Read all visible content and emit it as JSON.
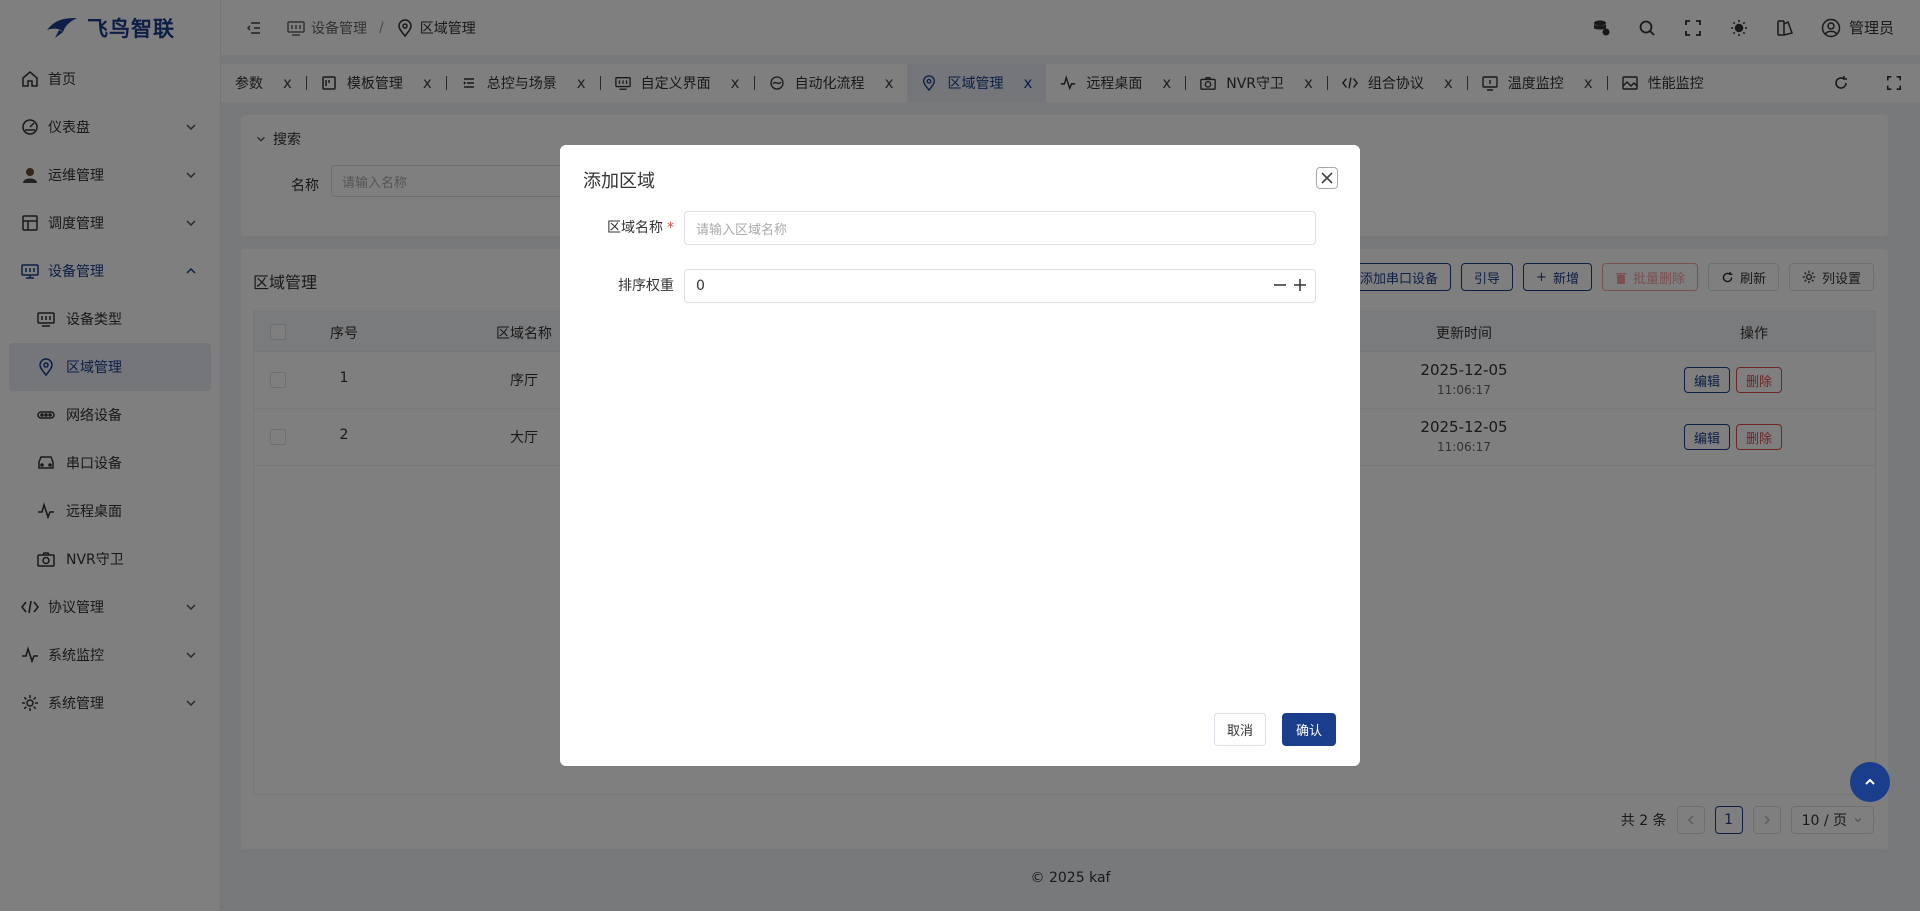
{
  "app": {
    "name": "飞鸟智联"
  },
  "colors": {
    "brand": "#1a3e8c",
    "danger": "#e04a4a",
    "overlay": "rgba(0,0,0,0.5)"
  },
  "sidebar": {
    "items": [
      {
        "label": "首页",
        "icon": "home-icon"
      },
      {
        "label": "仪表盘",
        "icon": "dashboard-icon"
      },
      {
        "label": "运维管理",
        "icon": "operator-icon"
      },
      {
        "label": "调度管理",
        "icon": "schedule-icon"
      },
      {
        "label": "设备管理",
        "icon": "device-icon"
      },
      {
        "label": "协议管理",
        "icon": "code-icon"
      },
      {
        "label": "系统监控",
        "icon": "pulse-icon"
      },
      {
        "label": "系统管理",
        "icon": "gear-icon"
      }
    ],
    "device_children": [
      {
        "label": "设备类型",
        "icon": "monitor-icon"
      },
      {
        "label": "区域管理",
        "icon": "location-icon"
      },
      {
        "label": "网络设备",
        "icon": "network-icon"
      },
      {
        "label": "串口设备",
        "icon": "serial-icon"
      },
      {
        "label": "远程桌面",
        "icon": "pulse-icon"
      },
      {
        "label": "NVR守卫",
        "icon": "camera-icon"
      }
    ]
  },
  "header": {
    "breadcrumb": [
      "设备管理",
      "区域管理"
    ],
    "separator": "/",
    "user": "管理员"
  },
  "tabs": [
    {
      "label": "参数"
    },
    {
      "label": "模板管理"
    },
    {
      "label": "总控与场景"
    },
    {
      "label": "自定义界面"
    },
    {
      "label": "自动化流程"
    },
    {
      "label": "区域管理",
      "active": true
    },
    {
      "label": "远程桌面"
    },
    {
      "label": "NVR守卫"
    },
    {
      "label": "组合协议"
    },
    {
      "label": "温度监控"
    },
    {
      "label": "性能监控"
    }
  ],
  "tab_close": "x",
  "search": {
    "title": "搜索",
    "name_label": "名称",
    "name_placeholder": "请输入名称"
  },
  "table": {
    "title": "区域管理",
    "toolbar": {
      "add_serial": "添加串口设备",
      "guide": "引导",
      "add": "新增",
      "batch_delete": "批量删除",
      "refresh": "刷新",
      "columns": "列设置"
    },
    "columns": {
      "index": "序号",
      "name": "区域名称",
      "updated": "更新时间",
      "actions": "操作"
    },
    "rows": [
      {
        "index": "1",
        "name": "序厅",
        "date": "2025-12-05",
        "time": "11:06:17"
      },
      {
        "index": "2",
        "name": "大厅",
        "date": "2025-12-05",
        "time": "11:06:17"
      }
    ],
    "edit_label": "编辑",
    "delete_label": "删除",
    "pager": {
      "total": "共 2 条",
      "current": "1",
      "size": "10 / 页"
    }
  },
  "footer": "© 2025 kaf",
  "dialog": {
    "title": "添加区域",
    "name_label": "区域名称",
    "required_mark": "*",
    "name_placeholder": "请输入区域名称",
    "order_label": "排序权重",
    "order_value": "0",
    "cancel": "取消",
    "confirm": "确认"
  }
}
